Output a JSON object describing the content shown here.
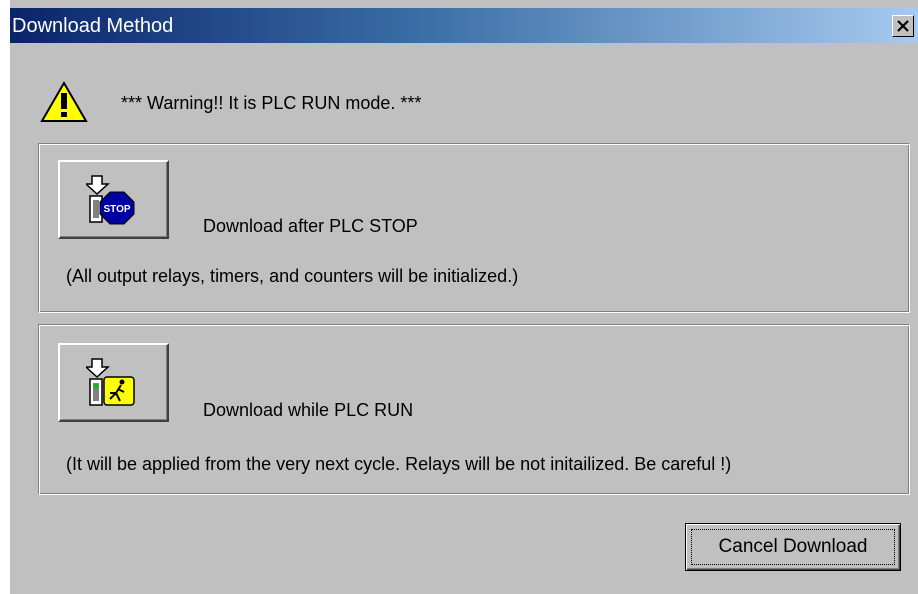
{
  "window": {
    "title": "Download Method",
    "close_icon": "close-icon"
  },
  "warning": {
    "icon": "warning-triangle-icon",
    "text": "*** Warning!! It is PLC RUN mode. ***"
  },
  "options": [
    {
      "icon": "plc-stop-icon",
      "label": "Download after PLC STOP",
      "description": "(All output relays, timers, and counters will be initialized.)"
    },
    {
      "icon": "plc-run-icon",
      "label": "Download while PLC RUN",
      "description": "(It will be applied from the very next cycle. Relays will be not initailized. Be careful !)"
    }
  ],
  "cancel_button": {
    "label": "Cancel Download"
  },
  "colors": {
    "dialog_bg": "#c0c0c0",
    "titlebar_start": "#0a246a",
    "titlebar_end": "#a6caf0",
    "warning_yellow": "#ffff00",
    "stop_blue": "#0000a0",
    "run_yellow": "#ffff00"
  }
}
